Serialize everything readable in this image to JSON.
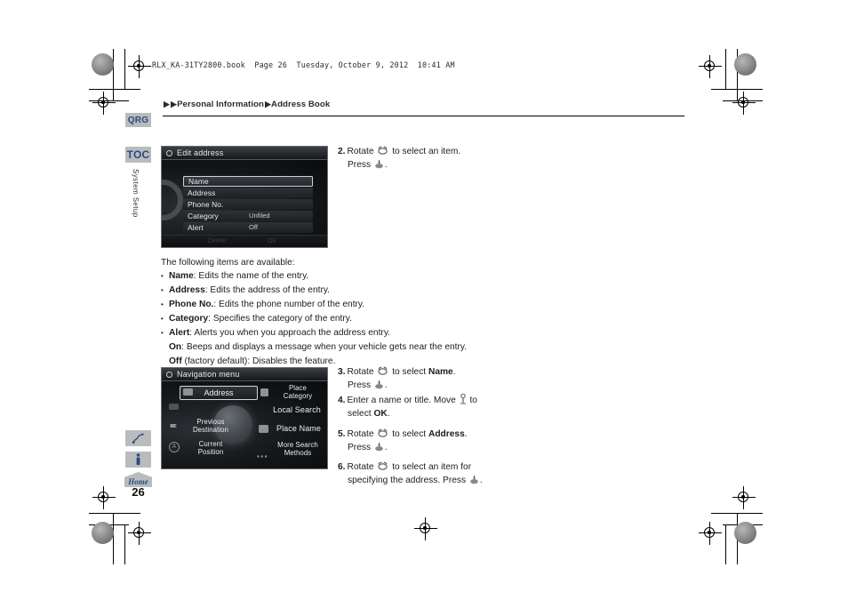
{
  "page": {
    "file_stamp": "RLX_KA-31TY2800.book  Page 26  Tuesday, October 9, 2012  10:41 AM",
    "page_number": "26"
  },
  "breadcrumb": {
    "arrow": "▶",
    "part1": "Personal Information",
    "part2": "Address Book"
  },
  "rail": {
    "qrg": "QRG",
    "toc": "TOC",
    "section": "System Setup",
    "home": "Home",
    "route_icon": "route-icon",
    "info_icon": "info-icon",
    "home_icon": "home-icon"
  },
  "screen_edit_address": {
    "title": "Edit address",
    "gear_icon": "gear-icon",
    "rows": [
      {
        "label": "Name",
        "value": "",
        "selected": true
      },
      {
        "label": "Address",
        "value": "",
        "selected": false
      },
      {
        "label": "Phone No.",
        "value": "",
        "selected": false
      },
      {
        "label": "Category",
        "value": "Unfiled",
        "selected": false
      },
      {
        "label": "Alert",
        "value": "Off",
        "selected": false
      }
    ],
    "footer_left": "Delete",
    "footer_right": "OK"
  },
  "screen_navigation_menu": {
    "title": "Navigation menu",
    "gear_icon": "gear-icon",
    "selected_item": "Address",
    "items": [
      {
        "label": "Place\nCategory",
        "icon": "place-category-icon"
      },
      {
        "label": "Local Search",
        "icon": "local-search-icon"
      },
      {
        "label": "Place Name",
        "icon": "place-name-icon"
      },
      {
        "label": "More Search\nMethods",
        "icon": "more-methods-icon"
      },
      {
        "label": "Previous\nDestination",
        "icon": "previous-destination-icon"
      },
      {
        "label": "Current\nPosition",
        "icon": "current-position-icon"
      }
    ]
  },
  "content": {
    "intro": "The following items are available:",
    "bullets": [
      {
        "term": "Name",
        "rest": ": Edits the name of the entry."
      },
      {
        "term": "Address",
        "rest": ": Edits the address of the entry."
      },
      {
        "term": "Phone No.",
        "rest": ": Edits the phone number of the entry."
      },
      {
        "term": "Category",
        "rest": ": Specifies the category of the entry."
      },
      {
        "term": "Alert",
        "rest": ": Alerts you when you approach the address entry."
      }
    ],
    "alert_on_term": "On",
    "alert_on_rest": ": Beeps and displays a message when your vehicle gets near the entry.",
    "alert_off_term": "Off",
    "alert_off_rest": " (factory default): Disables the feature."
  },
  "steps": [
    {
      "number": "2.",
      "line1_pre": "Rotate ",
      "line1_post": " to select an item.",
      "line2_pre": "Press ",
      "line2_post": "."
    },
    {
      "number": "3.",
      "line1_pre": "Rotate ",
      "line1_mid": " to select ",
      "line1_bold": "Name",
      "line1_post": ".",
      "line2_pre": "Press ",
      "line2_post": "."
    },
    {
      "number": "4.",
      "line1_pre": "Enter a name or title. Move ",
      "line1_post": " to",
      "line2_pre": "select ",
      "line2_bold": "OK",
      "line2_post": "."
    },
    {
      "number": "5.",
      "line1_pre": "Rotate ",
      "line1_mid": " to select ",
      "line1_bold": "Address",
      "line1_post": ".",
      "line2_pre": "Press ",
      "line2_post": "."
    },
    {
      "number": "6.",
      "line1_pre": "Rotate ",
      "line1_post": " to select an item for",
      "line2_pre": "specifying the address. Press ",
      "line2_post": "."
    }
  ],
  "colors": {
    "tab_bg": "#b9bcbf",
    "tab_text": "#2d4a7a",
    "rule": "#000000"
  }
}
